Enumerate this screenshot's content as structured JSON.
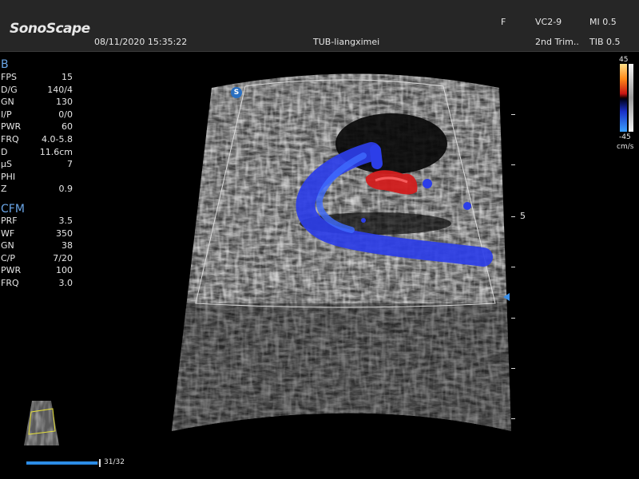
{
  "header": {
    "brand": "SonoScape",
    "datetime": "08/11/2020 15:35:22",
    "patient": "TUB-liangximei",
    "f_label": "F",
    "probe": "VC2-9",
    "preset": "2nd Trim..",
    "mi": "MI 0.5",
    "tib": "TIB 0.5"
  },
  "b_mode": {
    "title": "B",
    "params": [
      {
        "label": "FPS",
        "value": "15"
      },
      {
        "label": "D/G",
        "value": "140/4"
      },
      {
        "label": "GN",
        "value": "130"
      },
      {
        "label": "I/P",
        "value": "0/0"
      },
      {
        "label": "PWR",
        "value": "60"
      },
      {
        "label": "FRQ",
        "value": "4.0-5.8"
      },
      {
        "label": "D",
        "value": "11.6cm"
      },
      {
        "label": "μS",
        "value": "7"
      },
      {
        "label": "PHI",
        "value": ""
      },
      {
        "label": "Z",
        "value": "0.9"
      }
    ]
  },
  "cfm_mode": {
    "title": "CFM",
    "params": [
      {
        "label": "PRF",
        "value": "3.5"
      },
      {
        "label": "WF",
        "value": "350"
      },
      {
        "label": "GN",
        "value": "38"
      },
      {
        "label": "C/P",
        "value": "7/20"
      },
      {
        "label": "PWR",
        "value": "100"
      },
      {
        "label": "FRQ",
        "value": "3.0"
      }
    ]
  },
  "depth_scale": {
    "label": "5"
  },
  "color_scale": {
    "max": "45",
    "min": "-45",
    "unit": "cm/s"
  },
  "cine": {
    "frame_counter": "31/32",
    "progress": 0.97
  },
  "badge": "S",
  "colors": {
    "accent": "#6aa6e8",
    "flow_toward": "#d21e1e",
    "flow_away": "#2c3ee8",
    "cine_bar": "#2c8ce6"
  }
}
